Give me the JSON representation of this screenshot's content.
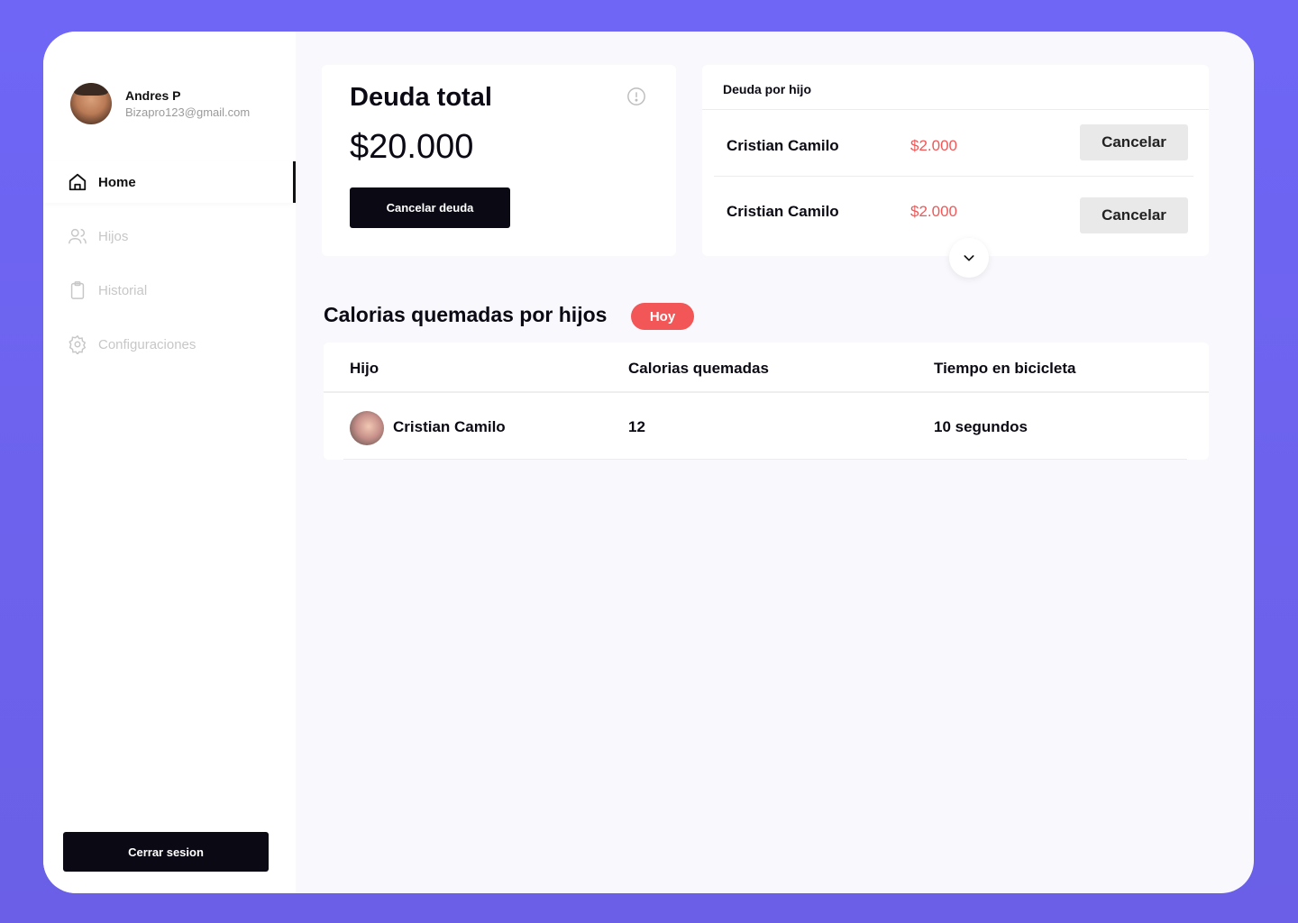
{
  "user": {
    "name": "Andres P",
    "email": "Bizapro123@gmail.com"
  },
  "nav": {
    "home": "Home",
    "hijos": "Hijos",
    "historial": "Historial",
    "configuraciones": "Configuraciones"
  },
  "logout_label": "Cerrar sesion",
  "debt": {
    "title": "Deuda total",
    "amount": "$20.000",
    "button": "Cancelar deuda"
  },
  "per_child": {
    "title": "Deuda por hijo",
    "rows": [
      {
        "name": "Cristian Camilo",
        "amount": "$2.000",
        "action": "Cancelar"
      },
      {
        "name": "Cristian Camilo",
        "amount": "$2.000",
        "action": "Cancelar"
      }
    ]
  },
  "calories": {
    "title": "Calorias quemadas por hijos",
    "badge": "Hoy",
    "headers": [
      "Hijo",
      "Calorias quemadas",
      "Tiempo en bicicleta"
    ],
    "rows": [
      {
        "child": "Cristian Camilo",
        "calories": "12",
        "time": "10 segundos"
      }
    ]
  },
  "colors": {
    "background": "#6c63f2",
    "accent_red": "#f25656",
    "dark": "#0b0a14"
  },
  "icons": {
    "home": "home-icon",
    "hijos": "users-icon",
    "historial": "clipboard-icon",
    "configuraciones": "gear-icon",
    "info": "info-icon",
    "expand": "chevron-down-icon"
  }
}
